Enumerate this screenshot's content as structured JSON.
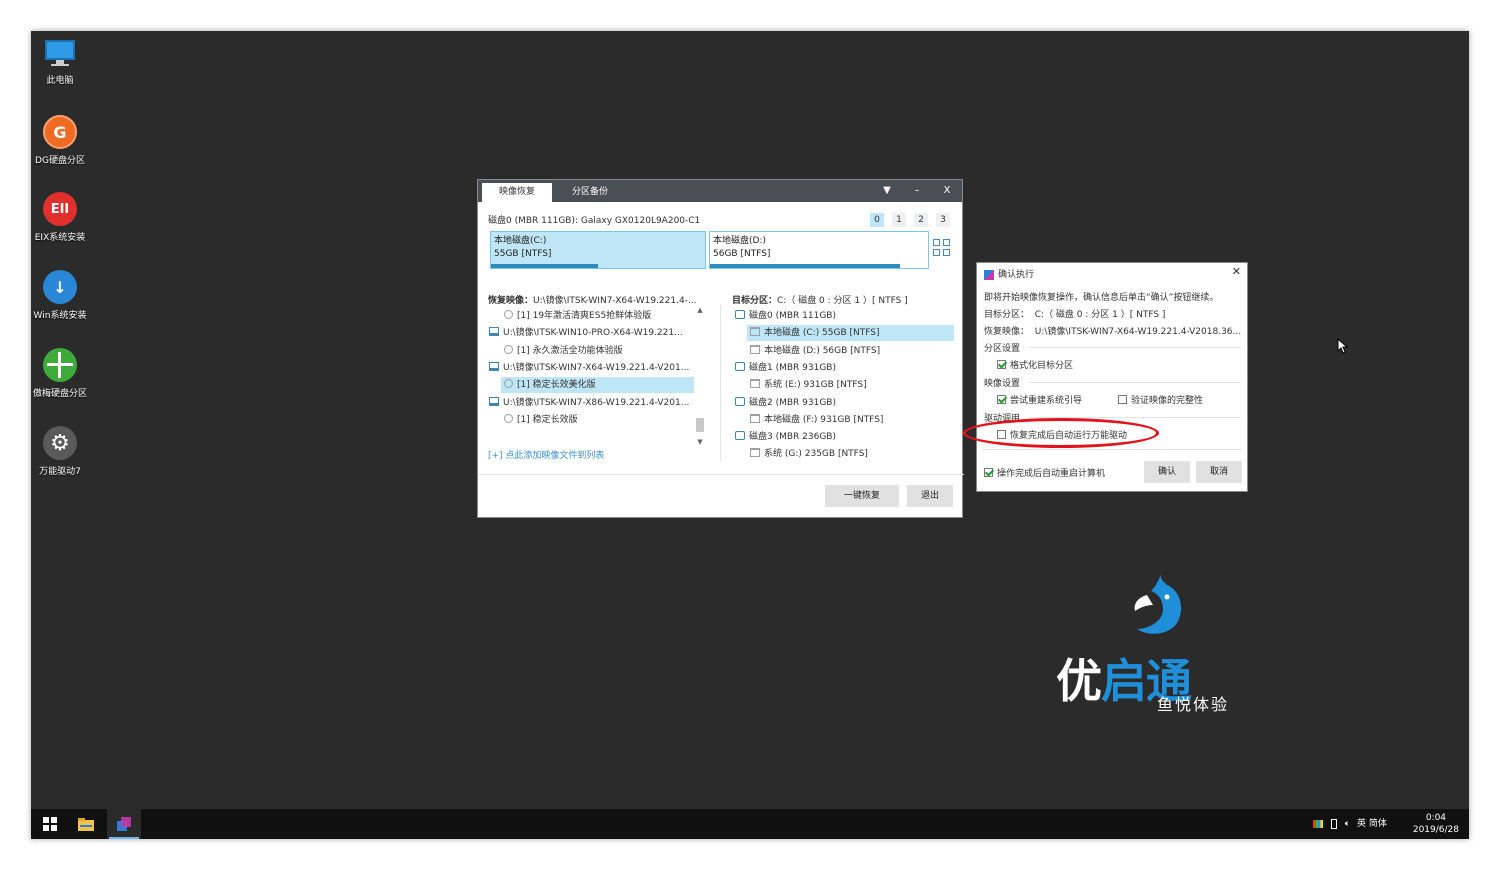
{
  "desktop": {
    "icons": [
      {
        "label": "此电脑",
        "icon": "computer-icon",
        "color": "#2f8fd8"
      },
      {
        "label": "DG硬盘分区",
        "icon": "dg-partition-icon",
        "color": "#f06a24",
        "glyph": "G"
      },
      {
        "label": "EIX系统安装",
        "icon": "eix-install-icon",
        "color": "#e0302d",
        "glyph": "EII"
      },
      {
        "label": "Win系统安装",
        "icon": "win-install-icon",
        "color": "#2a86d6",
        "glyph": "↓"
      },
      {
        "label": "傲梅硬盘分区",
        "icon": "aomei-partition-icon",
        "color": "#3eaa3a"
      },
      {
        "label": "万能驱动7",
        "icon": "universal-driver-icon",
        "color": "#5a5a5a",
        "glyph": "⚙"
      }
    ]
  },
  "main_window": {
    "tabs": [
      "映像恢复",
      "分区备份"
    ],
    "controls": {
      "dropdown": "▼",
      "minimize": "–",
      "close": "X"
    },
    "disk_header": "磁盘0 (MBR 111GB): Galaxy GX0120L9A200-C1",
    "disk_numbers": [
      "0",
      "1",
      "2",
      "3"
    ],
    "partitions": [
      {
        "name": "本地磁盘(C:)",
        "size": "55GB [NTFS]",
        "used_fraction": 0.5
      },
      {
        "name": "本地磁盘(D:)",
        "size": "56GB [NTFS]",
        "used_fraction": 0.87
      }
    ],
    "restore_image_label": "恢复映像：",
    "restore_image_value": "U:\\镜像\\ITSK-WIN7-X64-W19.221.4-...",
    "image_tree": [
      {
        "text": "[1] 19年激活清爽ES5抢鲜体验版",
        "level": 1,
        "icon": "image-icon",
        "selected": false
      },
      {
        "text": "U:\\镜像\\ITSK-WIN10-PRO-X64-W19.221...",
        "level": 0,
        "icon": "pc-icon",
        "selected": false
      },
      {
        "text": "[1] 永久激活全功能体验版",
        "level": 1,
        "icon": "image-icon",
        "selected": false
      },
      {
        "text": "U:\\镜像\\ITSK-WIN7-X64-W19.221.4-V201...",
        "level": 0,
        "icon": "pc-icon",
        "selected": false
      },
      {
        "text": "[1] 稳定长效美化版",
        "level": 1,
        "icon": "image-icon",
        "selected": true
      },
      {
        "text": "U:\\镜像\\ITSK-WIN7-X86-W19.221.4-V201...",
        "level": 0,
        "icon": "pc-icon",
        "selected": false
      },
      {
        "text": "[1] 稳定长效版",
        "level": 1,
        "icon": "image-icon",
        "selected": false
      }
    ],
    "add_link": "[+] 点此添加映像文件到列表",
    "target_label": "目标分区：",
    "target_value": "C:（ 磁盘 0 : 分区 1 ）[ NTFS ]",
    "target_tree": [
      {
        "text": "磁盘0 (MBR 111GB)",
        "level": 0,
        "icon": "disk-icon",
        "selected": false
      },
      {
        "text": "本地磁盘 (C:) 55GB [NTFS]",
        "level": 1,
        "icon": "folder-icon",
        "selected": true
      },
      {
        "text": "本地磁盘 (D:) 56GB [NTFS]",
        "level": 1,
        "icon": "folder-icon",
        "selected": false
      },
      {
        "text": "磁盘1 (MBR 931GB)",
        "level": 0,
        "icon": "disk-icon",
        "selected": false
      },
      {
        "text": "系统 (E:) 931GB [NTFS]",
        "level": 1,
        "icon": "folder-icon",
        "selected": false
      },
      {
        "text": "磁盘2 (MBR 931GB)",
        "level": 0,
        "icon": "disk-icon",
        "selected": false
      },
      {
        "text": "本地磁盘 (F:) 931GB [NTFS]",
        "level": 1,
        "icon": "folder-icon",
        "selected": false
      },
      {
        "text": "磁盘3 (MBR 236GB)",
        "level": 0,
        "icon": "disk-icon",
        "selected": false
      },
      {
        "text": "系统 (G:) 235GB [NTFS]",
        "level": 1,
        "icon": "folder-icon",
        "selected": false
      }
    ],
    "buttons": {
      "restore": "一键恢复",
      "exit": "退出"
    }
  },
  "confirm_dialog": {
    "title": "确认执行",
    "close": "✕",
    "message": "即将开始映像恢复操作，确认信息后单击“确认”按钮继续。",
    "target_label": "目标分区：",
    "target_value": "C:（ 磁盘 0 : 分区 1 ）[ NTFS ]",
    "image_label": "恢复映像：",
    "image_value": "U:\\镜像\\ITSK-WIN7-X64-W19.221.4-V2018.36...",
    "section_partition": "分区设置",
    "opt_format": {
      "label": "格式化目标分区",
      "checked": true
    },
    "section_image": "映像设置",
    "opt_rebuild_boot": {
      "label": "尝试重建系统引导",
      "checked": true
    },
    "opt_verify": {
      "label": "验证映像的完整性",
      "checked": false
    },
    "section_driver": "驱动调用",
    "opt_driver": {
      "label": "恢复完成后自动运行万能驱动",
      "checked": false
    },
    "opt_reboot": {
      "label": "操作完成后自动重启计算机",
      "checked": true
    },
    "btn_ok": "确认",
    "btn_cancel": "取消"
  },
  "logo": {
    "main_white": "优",
    "main_blue": "启通",
    "sub": "鱼悦体验",
    "color": "#1e8fd8"
  },
  "taskbar": {
    "tray_text": "英 简体",
    "time": "0:04",
    "date": "2019/6/28"
  }
}
